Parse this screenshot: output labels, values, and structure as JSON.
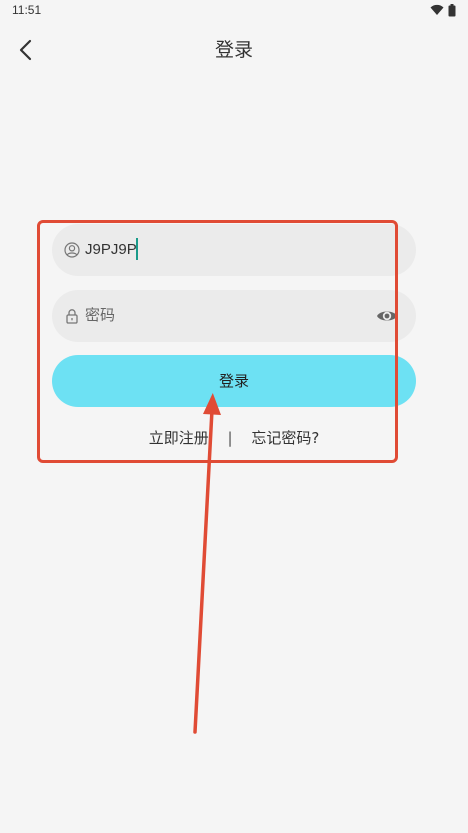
{
  "status_bar": {
    "time": "11:51",
    "icons": [
      "wifi-icon",
      "battery-icon"
    ]
  },
  "header": {
    "back_icon": "chevron-left-icon",
    "title": "登录"
  },
  "form": {
    "account": {
      "icon": "user-circle-icon",
      "value": "J9PJ9P"
    },
    "password": {
      "icon": "lock-icon",
      "placeholder": "密码",
      "toggle_icon": "eye-icon"
    },
    "login_label": "登录",
    "register_label": "立即注册",
    "divider": "|",
    "forgot_label": "忘记密码?"
  },
  "colors": {
    "background": "#f5f5f5",
    "field_background": "#ebebeb",
    "login_button": "#6de1f3",
    "annotation": "#e04b35",
    "caret": "#1a9b8a"
  }
}
